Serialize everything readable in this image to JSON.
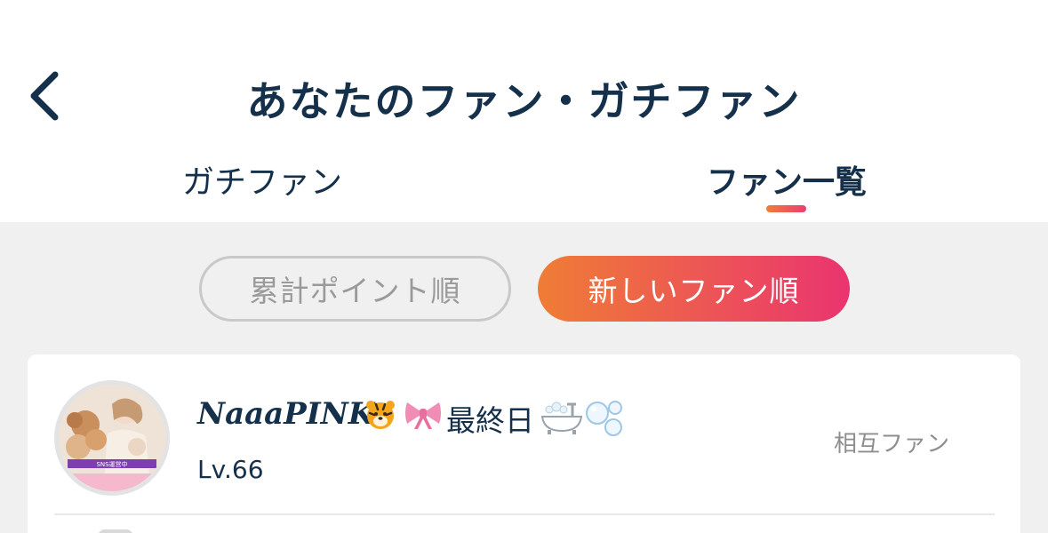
{
  "header": {
    "title": "あなたのファン・ガチファン"
  },
  "tabs": [
    {
      "label": "ガチファン",
      "active": false
    },
    {
      "label": "ファン一覧",
      "active": true
    }
  ],
  "sort": {
    "total_points": "累計ポイント順",
    "newest": "新しいファン順",
    "selected": "新しいファン順"
  },
  "fans": [
    {
      "name": "NaaaPINK",
      "name_suffix": "最終日",
      "level": "Lv.66",
      "status": "相互ファン",
      "avatar_badge": "SNS運営中"
    }
  ],
  "colors": {
    "text_primary": "#14304a",
    "accent_start": "#ef7d35",
    "accent_end": "#ea3470",
    "background": "#f0f0f0"
  }
}
